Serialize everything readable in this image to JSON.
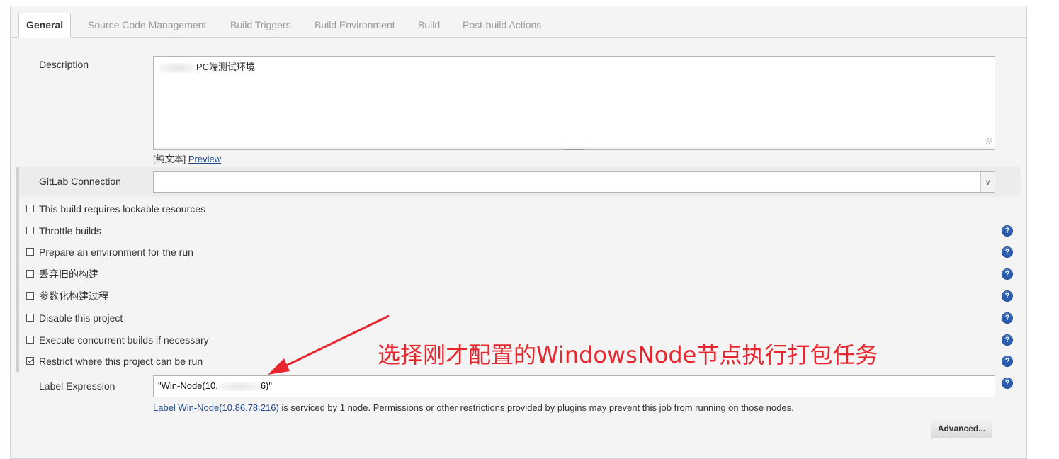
{
  "tabs": [
    {
      "label": "General",
      "active": true
    },
    {
      "label": "Source Code Management",
      "active": false
    },
    {
      "label": "Build Triggers",
      "active": false
    },
    {
      "label": "Build Environment",
      "active": false
    },
    {
      "label": "Build",
      "active": false
    },
    {
      "label": "Post-build Actions",
      "active": false
    }
  ],
  "description": {
    "label": "Description",
    "value_visible": "PC端测试环境",
    "plain_text_label": "[纯文本]",
    "preview_link": "Preview"
  },
  "gitlab": {
    "label": "GitLab Connection",
    "selected": ""
  },
  "options": [
    {
      "label": "This build requires lockable resources",
      "checked": false,
      "help": false
    },
    {
      "label": "Throttle builds",
      "checked": false,
      "help": true
    },
    {
      "label": "Prepare an environment for the run",
      "checked": false,
      "help": true
    },
    {
      "label": "丢弃旧的构建",
      "checked": false,
      "help": true
    },
    {
      "label": "参数化构建过程",
      "checked": false,
      "help": true
    },
    {
      "label": "Disable this project",
      "checked": false,
      "help": true
    },
    {
      "label": "Execute concurrent builds if necessary",
      "checked": false,
      "help": true
    },
    {
      "label": "Restrict where this project can be run",
      "checked": true,
      "help": true
    }
  ],
  "label_expression": {
    "label": "Label Expression",
    "value_prefix": "\"Win-Node(10.",
    "value_suffix": "6)\"",
    "info_link": "Label Win-Node(10.86.78.216)",
    "info_text": " is serviced by 1 node. Permissions or other restrictions provided by plugins may prevent this job from running on those nodes."
  },
  "advanced_button": "Advanced...",
  "annotation": {
    "text": "选择刚才配置的WindowsNode节点执行打包任务",
    "color": "#e8262d"
  },
  "colors": {
    "help_icon": "#2a5db0",
    "link": "#204a87"
  }
}
